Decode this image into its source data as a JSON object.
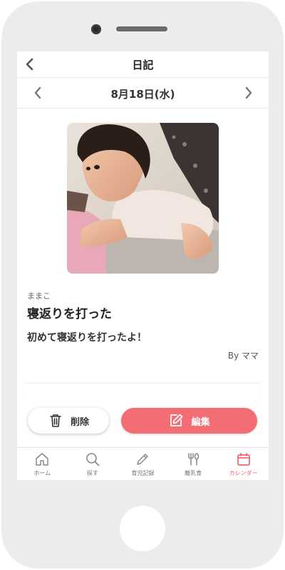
{
  "header": {
    "title": "日記"
  },
  "date_nav": {
    "date": "8月18日(水)"
  },
  "entry": {
    "author": "ままこ",
    "title": "寝返りを打った",
    "body": "初めて寝返りを打ったよ！",
    "byline": "By ママ"
  },
  "actions": {
    "delete_label": "削除",
    "edit_label": "編集"
  },
  "tabs": [
    {
      "label": "ホーム",
      "icon": "home-icon",
      "active": false
    },
    {
      "label": "探す",
      "icon": "search-icon",
      "active": false
    },
    {
      "label": "育児記録",
      "icon": "pencil-icon",
      "active": false
    },
    {
      "label": "離乳食",
      "icon": "utensils-icon",
      "active": false
    },
    {
      "label": "カレンダー",
      "icon": "calendar-icon",
      "active": true
    }
  ],
  "colors": {
    "accent": "#f26d74",
    "tab_active": "#f0646b"
  }
}
